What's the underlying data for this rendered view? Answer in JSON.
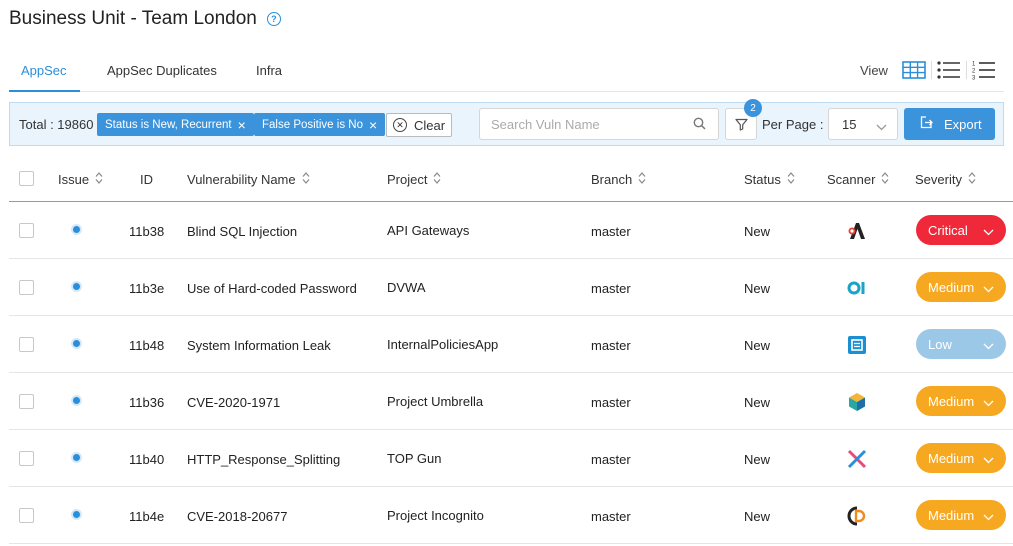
{
  "header": {
    "title": "Business Unit - Team London"
  },
  "tabs": [
    {
      "label": "AppSec"
    },
    {
      "label": "AppSec Duplicates"
    },
    {
      "label": "Infra"
    }
  ],
  "view": {
    "label": "View"
  },
  "filters": {
    "total": "Total : 19860",
    "chips": [
      "Status is New, Recurrent",
      "False Positive is No"
    ],
    "clear_label": "Clear",
    "search_placeholder": "Search Vuln Name",
    "filter_count": "2",
    "per_page_label": "Per Page :",
    "per_page_value": "15",
    "export_label": "Export"
  },
  "columns": {
    "issue": "Issue",
    "id": "ID",
    "vuln": "Vulnerability Name",
    "project": "Project",
    "branch": "Branch",
    "status": "Status",
    "scanner": "Scanner",
    "severity": "Severity"
  },
  "rows": [
    {
      "id": "11b38",
      "vuln": "Blind SQL Injection",
      "project": "API Gateways",
      "branch": "master",
      "status": "New",
      "scanner_icon": "scanner-a-icon",
      "severity": "Critical",
      "sev_color": "#f0293a"
    },
    {
      "id": "11b3e",
      "vuln": "Use of Hard-coded Password",
      "project": "DVWA",
      "branch": "master",
      "status": "New",
      "scanner_icon": "scanner-oi-icon",
      "severity": "Medium",
      "sev_color": "#f6a821"
    },
    {
      "id": "11b48",
      "vuln": "System Information Leak",
      "project": "InternalPoliciesApp",
      "branch": "master",
      "status": "New",
      "scanner_icon": "scanner-doc-icon",
      "severity": "Low",
      "sev_color": "#9cc8e8"
    },
    {
      "id": "11b36",
      "vuln": "CVE-2020-1971",
      "project": "Project Umbrella",
      "branch": "master",
      "status": "New",
      "scanner_icon": "scanner-cube-icon",
      "severity": "Medium",
      "sev_color": "#f6a821"
    },
    {
      "id": "11b40",
      "vuln": "HTTP_Response_Splitting",
      "project": "TOP Gun",
      "branch": "master",
      "status": "New",
      "scanner_icon": "scanner-x-icon",
      "severity": "Medium",
      "sev_color": "#f6a821"
    },
    {
      "id": "11b4e",
      "vuln": "CVE-2018-20677",
      "project": "Project Incognito",
      "branch": "master",
      "status": "New",
      "scanner_icon": "scanner-d-icon",
      "severity": "Medium",
      "sev_color": "#f6a821"
    }
  ]
}
